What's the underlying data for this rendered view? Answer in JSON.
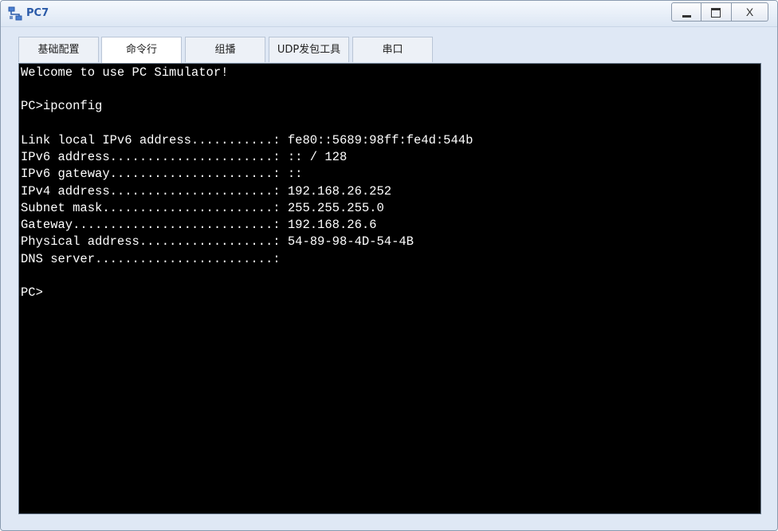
{
  "window": {
    "title": "PC7",
    "colors": {
      "title_text": "#2a5aa8",
      "terminal_bg": "#000000",
      "terminal_fg": "#ffffff"
    },
    "controls": {
      "minimize": "minimize-icon",
      "maximize": "maximize-icon",
      "close_label": "X"
    }
  },
  "tabs": [
    {
      "label": "基础配置",
      "active": false
    },
    {
      "label": "命令行",
      "active": true
    },
    {
      "label": "组播",
      "active": false
    },
    {
      "label": "UDP发包工具",
      "active": false
    },
    {
      "label": "串口",
      "active": false
    }
  ],
  "terminal": {
    "lines": [
      "Welcome to use PC Simulator!",
      "",
      "PC>ipconfig",
      "",
      "Link local IPv6 address...........: fe80::5689:98ff:fe4d:544b",
      "IPv6 address......................: :: / 128",
      "IPv6 gateway......................: ::",
      "IPv4 address......................: 192.168.26.252",
      "Subnet mask.......................: 255.255.255.0",
      "Gateway...........................: 192.168.26.6",
      "Physical address..................: 54-89-98-4D-54-4B",
      "DNS server........................:",
      "",
      "PC>"
    ]
  }
}
